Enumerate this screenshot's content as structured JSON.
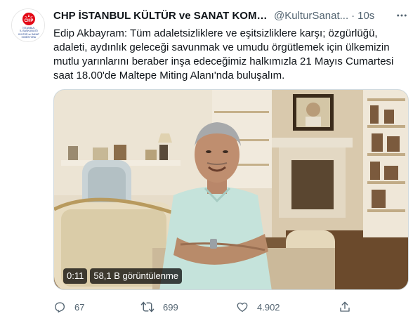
{
  "tweet": {
    "avatar": {
      "logo_text": "CHP",
      "caption_lines": [
        "İSTANBUL",
        "İL BAŞKANLIĞI",
        "KÜLTÜR ve SANAT",
        "KOMİSYONU"
      ]
    },
    "display_name": "CHP İSTANBUL KÜLTÜR ve SANAT KOMİS...",
    "handle": "@KulturSanat...",
    "separator": "·",
    "time": "10s",
    "text_lines": [
      "Edip Akbayram: Tüm adaletsizliklere ve eşitsizliklere karşı; özgürlüğü,",
      "adaleti, aydınlık geleceği savunmak ve umudu örgütlemek için ülkemizin",
      "mutlu yarınlarını beraber inşa edeceğimiz halkımızla 21 Mayıs Cumartesi",
      "saat 18.00'de Maltepe Miting Alanı'nda buluşalım."
    ],
    "video": {
      "duration": "0:11",
      "views": "58,1 B görüntülenme"
    },
    "actions": {
      "replies": "67",
      "retweets": "699",
      "likes": "4.902"
    }
  },
  "colors": {
    "text_primary": "#0f1419",
    "text_secondary": "#536471",
    "brand_red": "#e30a17",
    "border": "#cfd9de"
  },
  "icons": {
    "more": "more-horizontal-icon",
    "reply": "reply-icon",
    "retweet": "retweet-icon",
    "like": "heart-icon",
    "share": "share-icon"
  }
}
